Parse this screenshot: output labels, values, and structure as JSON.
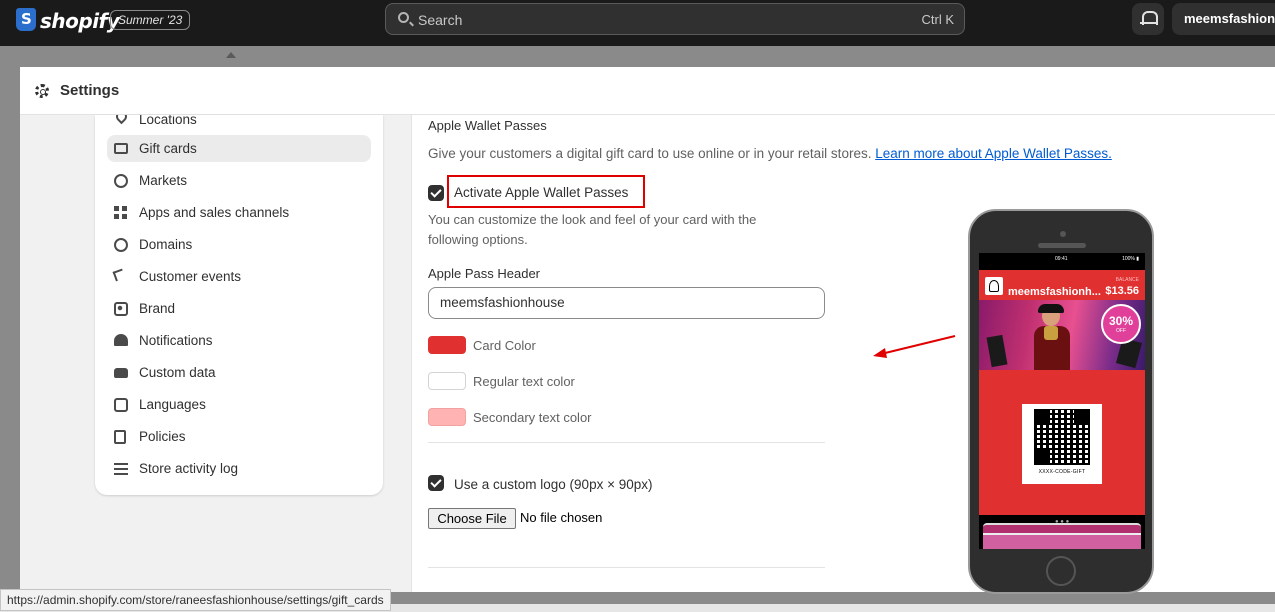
{
  "topbar": {
    "logo_text": "shopify",
    "edition": "Summer '23",
    "search_placeholder": "Search",
    "search_shortcut": "Ctrl K",
    "account_name": "meemsfashionhouse"
  },
  "modal": {
    "title": "Settings"
  },
  "sidebar": {
    "items": [
      {
        "label": "Locations",
        "icon": "location-pin-icon"
      },
      {
        "label": "Gift cards",
        "icon": "gift-card-icon",
        "active": true
      },
      {
        "label": "Markets",
        "icon": "globe-icon"
      },
      {
        "label": "Apps and sales channels",
        "icon": "apps-grid-icon"
      },
      {
        "label": "Domains",
        "icon": "globe-icon"
      },
      {
        "label": "Customer events",
        "icon": "cursor-sparkle-icon"
      },
      {
        "label": "Brand",
        "icon": "brand-image-icon"
      },
      {
        "label": "Notifications",
        "icon": "bell-icon"
      },
      {
        "label": "Custom data",
        "icon": "folder-icon"
      },
      {
        "label": "Languages",
        "icon": "language-icon"
      },
      {
        "label": "Policies",
        "icon": "policy-document-icon"
      },
      {
        "label": "Store activity log",
        "icon": "list-icon"
      }
    ]
  },
  "main": {
    "section_title": "Apple Wallet Passes",
    "description": "Give your customers a digital gift card to use online or in your retail stores.",
    "learn_more_link": "Learn more about Apple Wallet Passes.",
    "activate_label": "Activate Apple Wallet Passes",
    "activate_checked": true,
    "help_text": "You can customize the look and feel of your card with the following options.",
    "header_field_label": "Apple Pass Header",
    "header_field_value": "meemsfashionhouse",
    "colors": [
      {
        "label": "Card Color",
        "value": "#e03030"
      },
      {
        "label": "Regular text color",
        "value": "#ffffff"
      },
      {
        "label": "Secondary text color",
        "value": "#ffb3b3"
      }
    ],
    "custom_logo_label": "Use a custom logo (90px × 90px)",
    "custom_logo_checked": true,
    "choose_file_label": "Choose File",
    "file_status": "No file chosen"
  },
  "preview": {
    "status_time": "09:41",
    "status_battery": "100% ▮",
    "pass_name": "meemsfashionh...",
    "balance_label": "BALANCE",
    "balance_value": "$13.56",
    "sale_percent": "30%",
    "sale_off": "OFF",
    "code_text": "XXXX-CODE-GIFT"
  },
  "browser": {
    "status_url": "https://admin.shopify.com/store/raneesfashionhouse/settings/gift_cards"
  }
}
